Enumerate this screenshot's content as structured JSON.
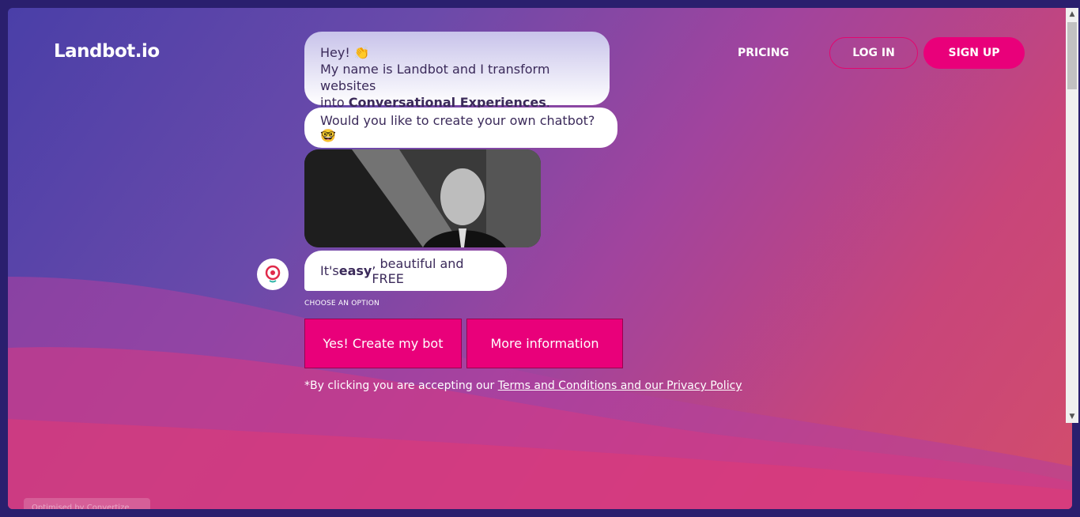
{
  "header": {
    "logo": "Landbot.io",
    "nav_pricing": "PRICING",
    "login_label": "LOG IN",
    "signup_label": "SIGN UP"
  },
  "chat": {
    "bubble1_greeting": "Hey! 👏",
    "bubble1_line2": "My name is Landbot and I transform websites",
    "bubble1_line3_pre": "into ",
    "bubble1_line3_bold": "Conversational Experiences",
    "bubble1_line3_post": ".",
    "bubble2": "Would you like to create your own chatbot? 🤓",
    "bubble3_pre": "It's ",
    "bubble3_bold": "easy",
    "bubble3_post": ", beautiful and FREE",
    "choose_label": "CHOOSE AN OPTION",
    "option1": "Yes! Create my bot",
    "option2": "More information",
    "disclaimer_pre": "*By clicking you are accepting our ",
    "disclaimer_link": "Terms and Conditions and our Privacy Policy"
  },
  "footer_badge": "Optimised by  Convertize",
  "colors": {
    "accent": "#e9007a",
    "text_dark": "#3b2a5a"
  }
}
